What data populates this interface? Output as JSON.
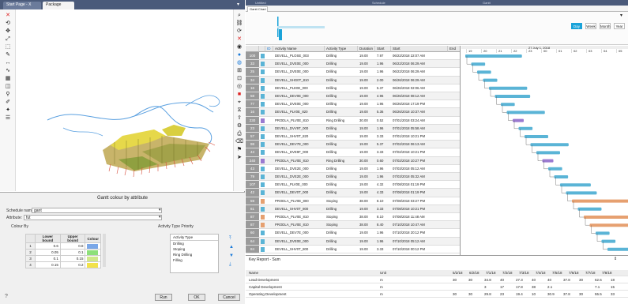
{
  "left_tabs": [
    {
      "label": "Start Page - X",
      "active": false
    },
    {
      "label": "Package",
      "active": true
    }
  ],
  "dialog": {
    "title": "Gantt colour by attribute",
    "schedule_label": "Schedule name:",
    "schedule_value": "gant",
    "attribute_label": "Attribute:",
    "attribute_value": "fut",
    "colour_by_label": "Colour By",
    "columns": [
      "Lower bound",
      "Upper bound",
      "Colour"
    ],
    "rows": [
      {
        "id": "1",
        "lower": "0.6",
        "upper": "0.8",
        "color": "#7aa7e8"
      },
      {
        "id": "2",
        "lower": "0.05",
        "upper": "0.1",
        "color": "#8de07a"
      },
      {
        "id": "3",
        "lower": "0.1",
        "upper": "0.15",
        "color": "#cfe88a"
      },
      {
        "id": "4",
        "lower": "0.15",
        "upper": "0.2",
        "color": "#f2e24a"
      }
    ],
    "priority_title": "Activity Type Priority",
    "priority_items": [
      "Activity Type",
      "Drilling",
      "Stoping",
      "Ring Drilling",
      "Filling"
    ],
    "buttons": {
      "run": "Run",
      "ok": "OK",
      "cancel": "Cancel"
    }
  },
  "right_title_items": [
    "Untitled",
    "Schedule",
    "Gantt"
  ],
  "gantt_tab": "Gantt Chart",
  "zoom": {
    "options": [
      "Day",
      "Week",
      "Month",
      "Year"
    ],
    "selected": "Day"
  },
  "timeline": {
    "date_label": "27 July 1, 2018",
    "hours": [
      "19",
      "20",
      "21",
      "22",
      "23",
      "00",
      "01",
      "02",
      "03",
      "04",
      "05"
    ]
  },
  "grid": {
    "headers": [
      "ID",
      "Activity Name",
      "Activity Type",
      "Duration",
      "Start",
      "Start",
      "End"
    ],
    "rows": [
      {
        "id": "100",
        "name": "DEVELL_PLOSE_003",
        "type": "Drilling",
        "dur": "19.00",
        "dur2": "7.97",
        "start": "06/22/2018 22:07 AM"
      },
      {
        "id": "33",
        "name": "DEVELL_DVE0E_000",
        "type": "Drilling",
        "dur": "19.00",
        "dur2": "1.96",
        "start": "06/22/2018 06:29 AM"
      },
      {
        "id": "25",
        "name": "DEVELL_DVE0E_000",
        "type": "Drilling",
        "dur": "19.00",
        "dur2": "1.96",
        "start": "06/22/2018 06:29 AM"
      },
      {
        "id": "34",
        "name": "DEVELL_SHG0T_810",
        "type": "Drilling",
        "dur": "19.00",
        "dur2": "2.00",
        "start": "06/26/2018 06:29 AM"
      },
      {
        "id": "16",
        "name": "DEVELL_PLE0E_000",
        "type": "Drilling",
        "dur": "19.00",
        "dur2": "5.37",
        "start": "06/26/2018 02:06 AM"
      },
      {
        "id": "58",
        "name": "DEVELL_DEV0E_000",
        "type": "Drilling",
        "dur": "19.00",
        "dur2": "4.96",
        "start": "06/26/2018 08:12 AM"
      },
      {
        "id": "77",
        "name": "DEVELL_DVE0E_000",
        "type": "Drilling",
        "dur": "19.00",
        "dur2": "1.96",
        "start": "06/26/2018 17:19 PM"
      },
      {
        "id": "16",
        "name": "DEVELL_PLV0E_820",
        "type": "Drilling",
        "dur": "19.00",
        "dur2": "5.36",
        "start": "06/26/2018 10:37 AM"
      },
      {
        "id": "230",
        "name": "PRODLA_PLV0E_810",
        "type": "Ring Drilling",
        "dur": "30.00",
        "dur2": "0.52",
        "start": "07/01/2018 03:24 AM"
      },
      {
        "id": "23",
        "name": "DEVELL_DVV9T_000",
        "type": "Drilling",
        "dur": "19.00",
        "dur2": "1.96",
        "start": "07/01/2018 05:58 AM"
      },
      {
        "id": "57",
        "name": "DEVELL_SHV0T_820",
        "type": "Drilling",
        "dur": "19.00",
        "dur2": "3.33",
        "start": "07/01/2018 10:21 PM"
      },
      {
        "id": "98",
        "name": "DEVELL_DEV7E_000",
        "type": "Drilling",
        "dur": "19.00",
        "dur2": "5.37",
        "start": "07/02/2018 06:13 AM"
      },
      {
        "id": "43",
        "name": "DEVELL_DVE9F_000",
        "type": "Drilling",
        "dur": "19.00",
        "dur2": "3.33",
        "start": "07/02/2018 10:21 PM"
      },
      {
        "id": "240",
        "name": "PRODLA_PLV0E_810",
        "type": "Ring Drilling",
        "dur": "30.00",
        "dur2": "0.60",
        "start": "07/02/2018 10:27 PM"
      },
      {
        "id": "43",
        "name": "DEVELL_DVE2E_000",
        "type": "Drilling",
        "dur": "19.00",
        "dur2": "1.96",
        "start": "07/03/2018 05:12 AM"
      },
      {
        "id": "79",
        "name": "DEVELL_DVE2E_000",
        "type": "Drilling",
        "dur": "19.00",
        "dur2": "1.96",
        "start": "07/03/2018 05:32 AM"
      },
      {
        "id": "107",
        "name": "DEVELL_PLV0E_000",
        "type": "Drilling",
        "dur": "19.00",
        "dur2": "4.32",
        "start": "07/08/2018 01:19 PM"
      },
      {
        "id": "42",
        "name": "DEVELL_DEV0T_000",
        "type": "Drilling",
        "dur": "19.00",
        "dur2": "4.33",
        "start": "07/08/2018 01:19 PM"
      },
      {
        "id": "59",
        "name": "PRODLA_PLV0E_800",
        "type": "Stoping",
        "dur": "38.00",
        "dur2": "8.10",
        "start": "07/08/2018 03:27 PM"
      },
      {
        "id": "61",
        "name": "DEVELL_SHV0T_800",
        "type": "Drilling",
        "dur": "19.00",
        "dur2": "3.33",
        "start": "07/08/2018 10:21 PM"
      },
      {
        "id": "87",
        "name": "PRODLA_PLV0E_810",
        "type": "Stoping",
        "dur": "38.00",
        "dur2": "8.10",
        "start": "07/08/2018 11:48 AM"
      },
      {
        "id": "87",
        "name": "PRODLA_PLV0E_810",
        "type": "Stoping",
        "dur": "38.00",
        "dur2": "8.40",
        "start": "07/10/2018 10:47 AM"
      },
      {
        "id": "60",
        "name": "DEVELL_DEV7E_000",
        "type": "Drilling",
        "dur": "19.00",
        "dur2": "1.96",
        "start": "07/10/2018 20:12 PM"
      },
      {
        "id": "64",
        "name": "DEVELL_DVE0E_000",
        "type": "Drilling",
        "dur": "19.00",
        "dur2": "1.96",
        "start": "07/10/2018 05:12 AM"
      },
      {
        "id": "84",
        "name": "DEVELL_SHV0T_800",
        "type": "Drilling",
        "dur": "19.00",
        "dur2": "3.33",
        "start": "07/10/2018 00:12 PM"
      }
    ]
  },
  "report": {
    "title": "Key Report - Sum",
    "col_name": "Name",
    "col_unit": "Unit",
    "periods": [
      "5/2/18",
      "6/2/18",
      "7/1/18",
      "7/2/18",
      "7/3/18",
      "7/4/18",
      "7/5/18",
      "7/6/18",
      "7/7/18",
      "7/8/18"
    ],
    "rows": [
      {
        "name": "Lead Development",
        "unit": "m",
        "vals": [
          "30",
          "30",
          "34.8",
          "40",
          "27.3",
          "40",
          "40",
          "37.8",
          "30",
          "62.6",
          "18"
        ]
      },
      {
        "name": "Capital Development",
        "unit": "m",
        "vals": [
          "",
          "",
          "3",
          "17",
          "17.8",
          "38",
          "2.1",
          "",
          "",
          "7.1",
          "15"
        ]
      },
      {
        "name": "Operating Development",
        "unit": "m",
        "vals": [
          "30",
          "30",
          "29.8",
          "23",
          "19.4",
          "10",
          "30.9",
          "37.8",
          "30",
          "55.5",
          "33"
        ]
      }
    ]
  }
}
